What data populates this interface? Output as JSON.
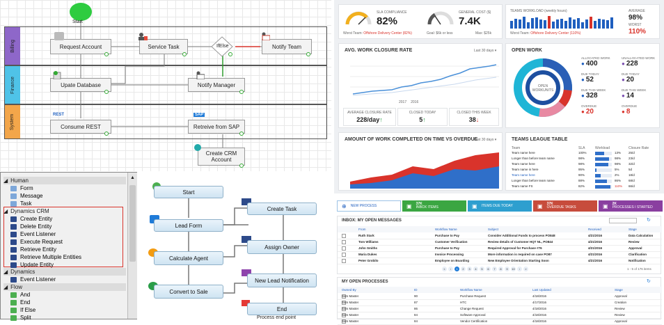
{
  "workflow": {
    "start_label": "Start",
    "lanes": [
      "Billing",
      "Finance",
      "System"
    ],
    "nodes": {
      "request_account": "Request Account",
      "service_task": "Service Task",
      "ifelse": "IfElse",
      "notify_team": "Notify Team",
      "update_database": "Upate Database",
      "notify_manager": "Notify Manager",
      "consume_rest": "Consume REST",
      "retreive_sap": "Retreive from SAP",
      "create_crm": "Create CRM Account"
    },
    "rest_tag": "REST",
    "sap_tag": "SAP"
  },
  "dashboard": {
    "sla": {
      "label": "SLA COMPLIANCE",
      "value": "82%",
      "foot_prefix": "Worst Team: ",
      "foot_team": "Offshore Delivery Center (82%)"
    },
    "cost": {
      "label": "GENERAL COST ($)",
      "value": "7.4K",
      "foot_left": "Goal: $6k or less",
      "foot_right": "Max: $25k"
    },
    "workload": {
      "label": "TEAMS WORKLOAD (weekly hours)",
      "avg_label": "AVERAGE",
      "avg_value": "98%",
      "worst_label": "WORST",
      "worst_value": "110%",
      "foot_prefix": "Worst Team: ",
      "foot_team": "Offshore Delivery Center (110%)"
    },
    "closure": {
      "title": "AVG. WORK CLOSURE RATE",
      "range": "Last 30 days ▾",
      "legend": [
        "2017",
        "2016"
      ],
      "stats": [
        {
          "label": "AVERAGE CLOSURE RATE",
          "value": "228/day",
          "arrow": "↑",
          "color": "#2a9d48"
        },
        {
          "label": "CLOSED TODAY",
          "value": "5",
          "arrow": "↑",
          "color": "#2a9d48"
        },
        {
          "label": "CLOSED THIS WEEK",
          "value": "38",
          "arrow": "↓",
          "color": "#d9332b"
        }
      ]
    },
    "open_work": {
      "title": "OPEN WORK",
      "center_label": "OPEN WORKUNITS",
      "items_left": [
        {
          "label": "ALLOCATED WORK",
          "value": "400",
          "color": "#1f5fbf"
        },
        {
          "label": "DUE TODAY",
          "value": "52",
          "color": "#1f5fbf"
        },
        {
          "label": "DUE THIS WEEK",
          "value": "328",
          "color": "#1f5fbf"
        },
        {
          "label": "OVERDUE",
          "value": "20",
          "color": "#d9332b"
        }
      ],
      "items_right": [
        {
          "label": "UNALLOCATED WORK",
          "value": "228",
          "color": "#7a4fb0"
        },
        {
          "label": "DUE TODAY",
          "value": "20",
          "color": "#7a4fb0"
        },
        {
          "label": "DUE THIS WEEK",
          "value": "14",
          "color": "#7a4fb0"
        },
        {
          "label": "OVERDUE",
          "value": "8",
          "color": "#d9332b"
        }
      ]
    },
    "overdue": {
      "title": "AMOUNT OF WORK COMPLETED ON TIME VS OVERDUE",
      "range": "Last 30 days ▾"
    },
    "league": {
      "title": "TEAMS LEAGUE TABLE",
      "headers": [
        "Team",
        "SLA",
        "Workload",
        "Closure Rate"
      ],
      "rows": [
        {
          "team": "Team name here",
          "sla": "100%",
          "load": 0.55,
          "pct": "13%",
          "rate": "25/d"
        },
        {
          "team": "Longer than before team name",
          "sla": "98%",
          "load": 0.85,
          "pct": "98%",
          "rate": "23/d"
        },
        {
          "team": "Team name here",
          "sla": "98%",
          "load": 0.78,
          "pct": "98%",
          "rate": "32/d"
        },
        {
          "team": "Team name in here",
          "sla": "95%",
          "load": 0.1,
          "pct": "5%",
          "rate": "5d"
        },
        {
          "team": "Team name here",
          "sla": "90%",
          "load": 0.35,
          "pct": "2%",
          "rate": "18/d"
        },
        {
          "team": "Longer than before team name",
          "sla": "88%",
          "load": 0.7,
          "pct": "86%",
          "rate": "68/d"
        },
        {
          "team": "Team name FS",
          "sla": "82%",
          "load": 0.92,
          "pct": "110%",
          "rate": "66/d"
        }
      ]
    }
  },
  "toolbox": {
    "human_header": "Human",
    "human_items": [
      "Form",
      "Message",
      "Task"
    ],
    "crm_header": "Dynamics CRM",
    "crm_items": [
      "Create Entity",
      "Delete Entity",
      "Event Listener",
      "Execute Request",
      "Retrieve Entity",
      "Retrieve Multiple Entities",
      "Update Entity"
    ],
    "dyn_header": "Dynamics",
    "dyn_items": [
      "Event Listener"
    ],
    "flow_header": "Flow",
    "flow_items": [
      "And",
      "End",
      "If Else",
      "Split"
    ]
  },
  "flowchart": {
    "start": "Start",
    "lead_form": "Lead Form",
    "calculate_agent": "Calculate Agent",
    "convert_sale": "Convert to Sale",
    "create_task": "Create Task",
    "assign_owner": "Assign Owner",
    "new_lead": "New Lead Notification",
    "end": "End",
    "footer": "Process end point"
  },
  "portal": {
    "new_process": "NEW PROCESS",
    "tiles": [
      {
        "count": "37K",
        "label": "INBOX ITEMS",
        "color": "#3ba642"
      },
      {
        "count": "",
        "label": "ITEMS DUE TODAY",
        "color": "#2e9fcf"
      },
      {
        "count": "37K",
        "label": "OVERDUE TASKS",
        "color": "#c74c3c"
      },
      {
        "count": "2K",
        "label": "PROCESSES I STARTED",
        "color": "#8a3fa0"
      }
    ],
    "inbox": {
      "title": "INBOX: MY OPEN MESSAGES",
      "headers": [
        "From",
        "Workflow Name",
        "Subject",
        "Received",
        "Stage"
      ],
      "rows": [
        [
          "Ruth Stark",
          "Purchase to Pay",
          "Consider Additional Funds to process PO848",
          "4/21/2016",
          "Data Calculation"
        ],
        [
          "Tom Williams",
          "Customer Verification",
          "Review details of Customer HQT NL, PO844",
          "4/21/2016",
          "Review"
        ],
        [
          "John Smiths",
          "Purchase to Pay",
          "Required Approval for Purchase #76",
          "4/21/2016",
          "Approval"
        ],
        [
          "Maria Dukes",
          "Invoice Processing",
          "More information is required on case PO87",
          "4/21/2016",
          "Clarification"
        ],
        [
          "Peter Grobilo",
          "Employee on Boarding",
          "New Employee Orientation Starting Soon",
          "4/21/2016",
          "Notification"
        ]
      ],
      "pager": "1 - 5 of 176 items"
    },
    "processes": {
      "title": "MY OPEN PROCESSES",
      "headers": [
        "Owned By",
        "ID",
        "Workflow Name",
        "Last Updated",
        "Stage"
      ],
      "rows": [
        [
          "Sam Master",
          "90",
          "Purchase Request",
          "4/18/2016",
          "Approval"
        ],
        [
          "Sam Master",
          "87",
          "HTC",
          "4/17/2016",
          "Creation"
        ],
        [
          "Sam Master",
          "86",
          "Change Request",
          "4/18/2016",
          "Review"
        ],
        [
          "Sam Master",
          "84",
          "Software Approval",
          "4/18/2016",
          "Review"
        ],
        [
          "Sam Master",
          "84",
          "Vendor Certification",
          "4/18/2016",
          "Approval"
        ]
      ]
    }
  }
}
